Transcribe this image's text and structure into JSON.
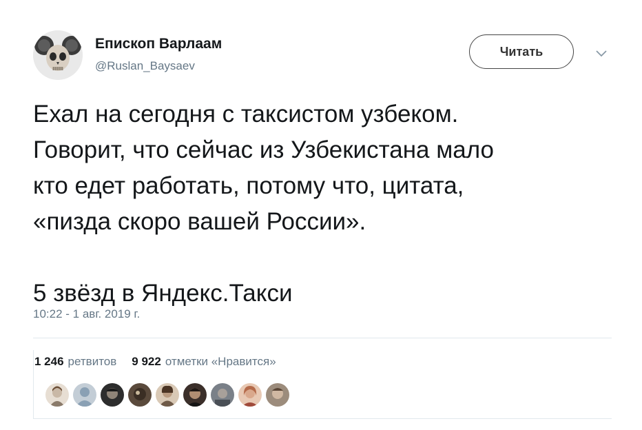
{
  "author": {
    "name": "Епископ Варлаам",
    "handle": "@Ruslan_Baysaev",
    "avatar_icon": "skull-mouse-ears-avatar"
  },
  "follow_button": {
    "label": "Читать"
  },
  "menu": {
    "icon": "chevron-down-icon"
  },
  "tweet": {
    "lines": [
      "Ехал на сегодня с таксистом узбеком.",
      "Говорит, что сейчас из Узбекистана мало",
      "кто едет работать, потому что, цитата,",
      "«пизда скоро вашей России»."
    ],
    "footer_line": "5 звёзд в Яндекс.Такси"
  },
  "timestamp": "10:22 - 1 авг. 2019 г.",
  "stats": {
    "retweets": {
      "count": "1 246",
      "label": "ретвитов"
    },
    "likes": {
      "count": "9 922",
      "label": "отметки «Нравится»"
    }
  },
  "likers": [
    {
      "icon": "liker-avatar-1",
      "color": "#c9b8a6"
    },
    {
      "icon": "liker-avatar-2-default",
      "color": "#c3cdd6"
    },
    {
      "icon": "liker-avatar-3",
      "color": "#2d2d2d"
    },
    {
      "icon": "liker-avatar-4",
      "color": "#5a4a3c"
    },
    {
      "icon": "liker-avatar-5",
      "color": "#b89a80"
    },
    {
      "icon": "liker-avatar-6",
      "color": "#3b2f2a"
    },
    {
      "icon": "liker-avatar-7",
      "color": "#7a8088"
    },
    {
      "icon": "liker-avatar-8",
      "color": "#b46a4a"
    },
    {
      "icon": "liker-avatar-9",
      "color": "#9c8c7c"
    }
  ],
  "colors": {
    "text": "#14171a",
    "secondary": "#657786",
    "divider": "#e1e8ed"
  }
}
